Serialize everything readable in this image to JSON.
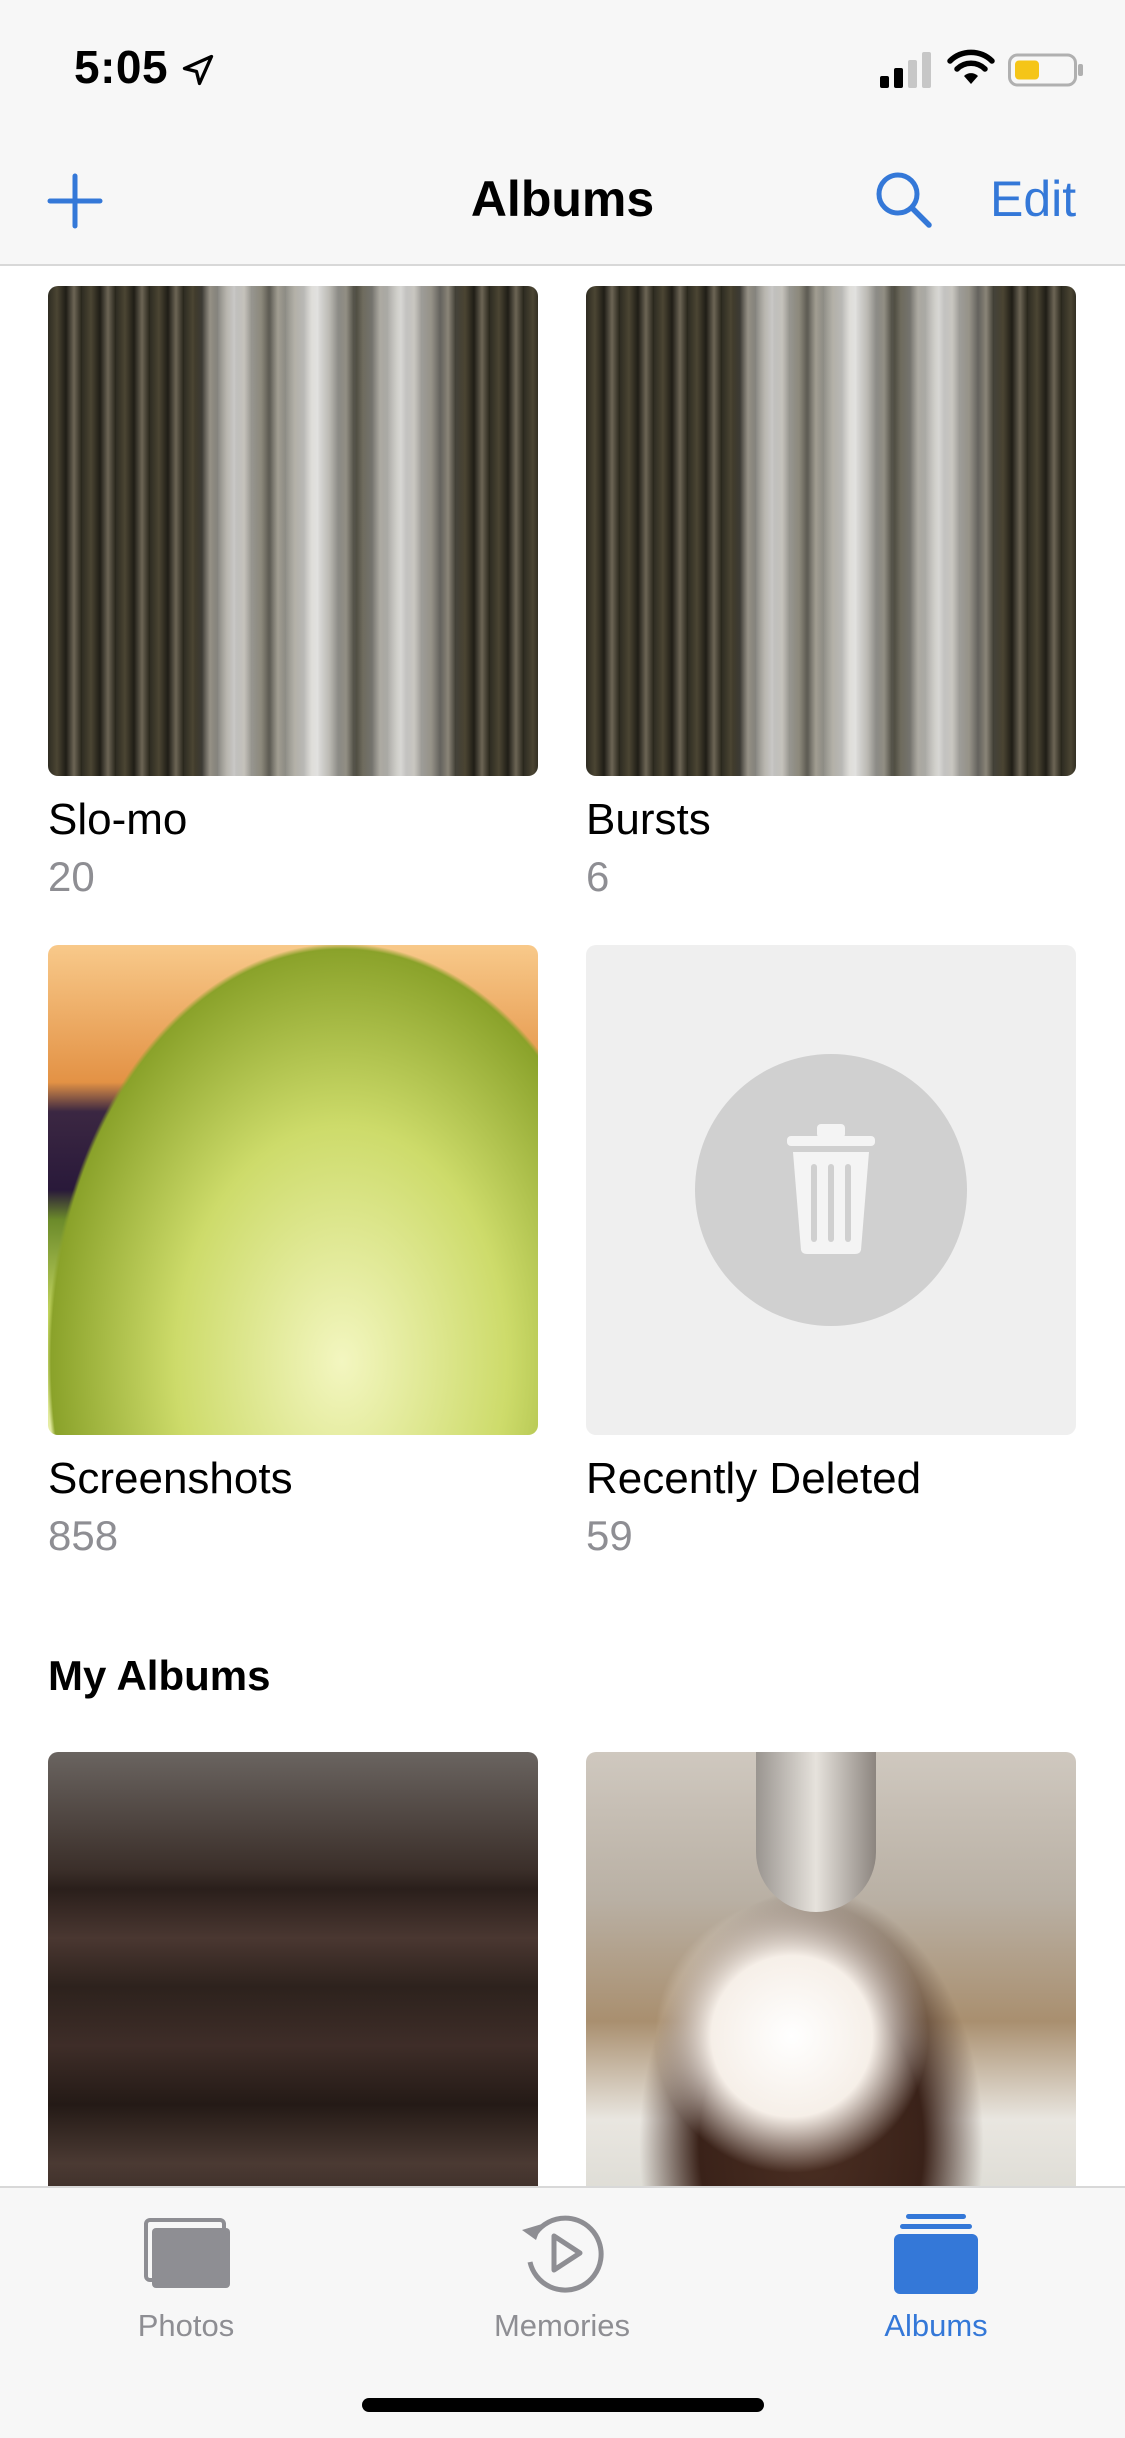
{
  "status_bar": {
    "time": "5:05",
    "location_icon": "location-arrow-icon",
    "signal_icon": "cellular-signal-icon",
    "wifi_icon": "wifi-icon",
    "battery_icon": "battery-low-power-icon"
  },
  "nav": {
    "title": "Albums",
    "add_icon": "plus-icon",
    "search_icon": "search-icon",
    "edit_label": "Edit"
  },
  "albums": [
    {
      "title": "Slo-mo",
      "count": "20"
    },
    {
      "title": "Bursts",
      "count": "6"
    },
    {
      "title": "Screenshots",
      "count": "858"
    },
    {
      "title": "Recently Deleted",
      "count": "59"
    }
  ],
  "sections": {
    "my_albums": "My Albums"
  },
  "tab_bar": {
    "tabs": [
      {
        "label": "Photos",
        "icon": "photos-stack-icon"
      },
      {
        "label": "Memories",
        "icon": "memories-play-icon"
      },
      {
        "label": "Albums",
        "icon": "albums-folder-icon"
      }
    ],
    "active_index": 2
  },
  "colors": {
    "accent": "#3478d8",
    "secondary_text": "#8e8e93",
    "bar_background": "#f7f7f7"
  }
}
